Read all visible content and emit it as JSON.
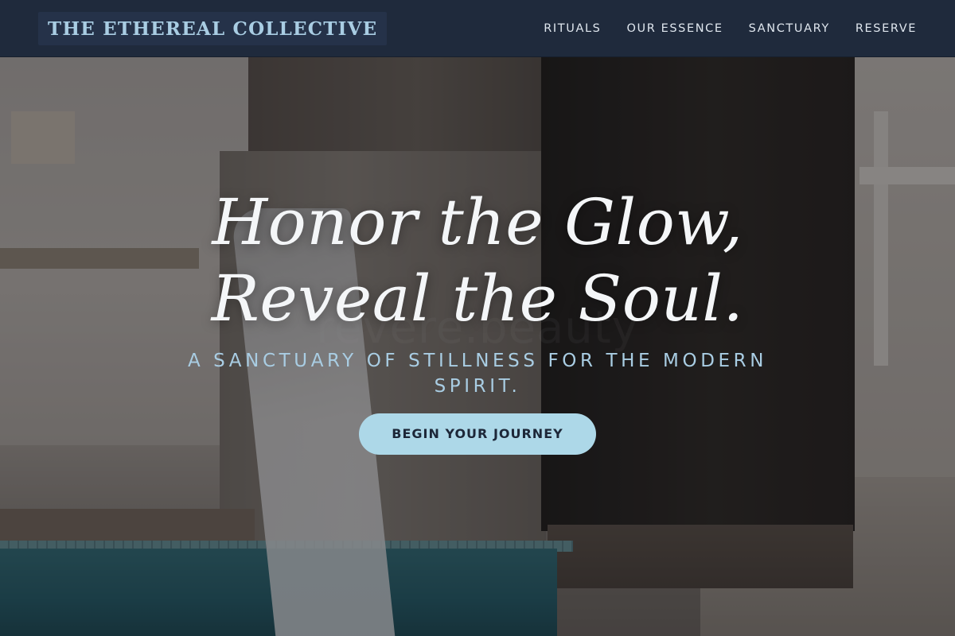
{
  "header": {
    "brand": "THE ETHEREAL COLLECTIVE",
    "nav": [
      {
        "label": "RITUALS"
      },
      {
        "label": "OUR ESSENCE"
      },
      {
        "label": "SANCTUARY"
      },
      {
        "label": "RESERVE"
      }
    ]
  },
  "hero": {
    "headline_line1": "Honor the Glow,",
    "headline_line2": "Reveal the Soul.",
    "tagline": "A SANCTUARY OF STILLNESS FOR THE MODERN SPIRIT.",
    "cta_label": "BEGIN YOUR JOURNEY",
    "background_watermark": "revere.beauty"
  },
  "colors": {
    "header_bg": "#1f2a3c",
    "brand_text": "#a9cde3",
    "nav_text": "#dfe6ee",
    "headline_text": "#f4f6f8",
    "tagline_text": "#a9cde3",
    "cta_bg": "#add8e8",
    "cta_text": "#1d2738"
  }
}
